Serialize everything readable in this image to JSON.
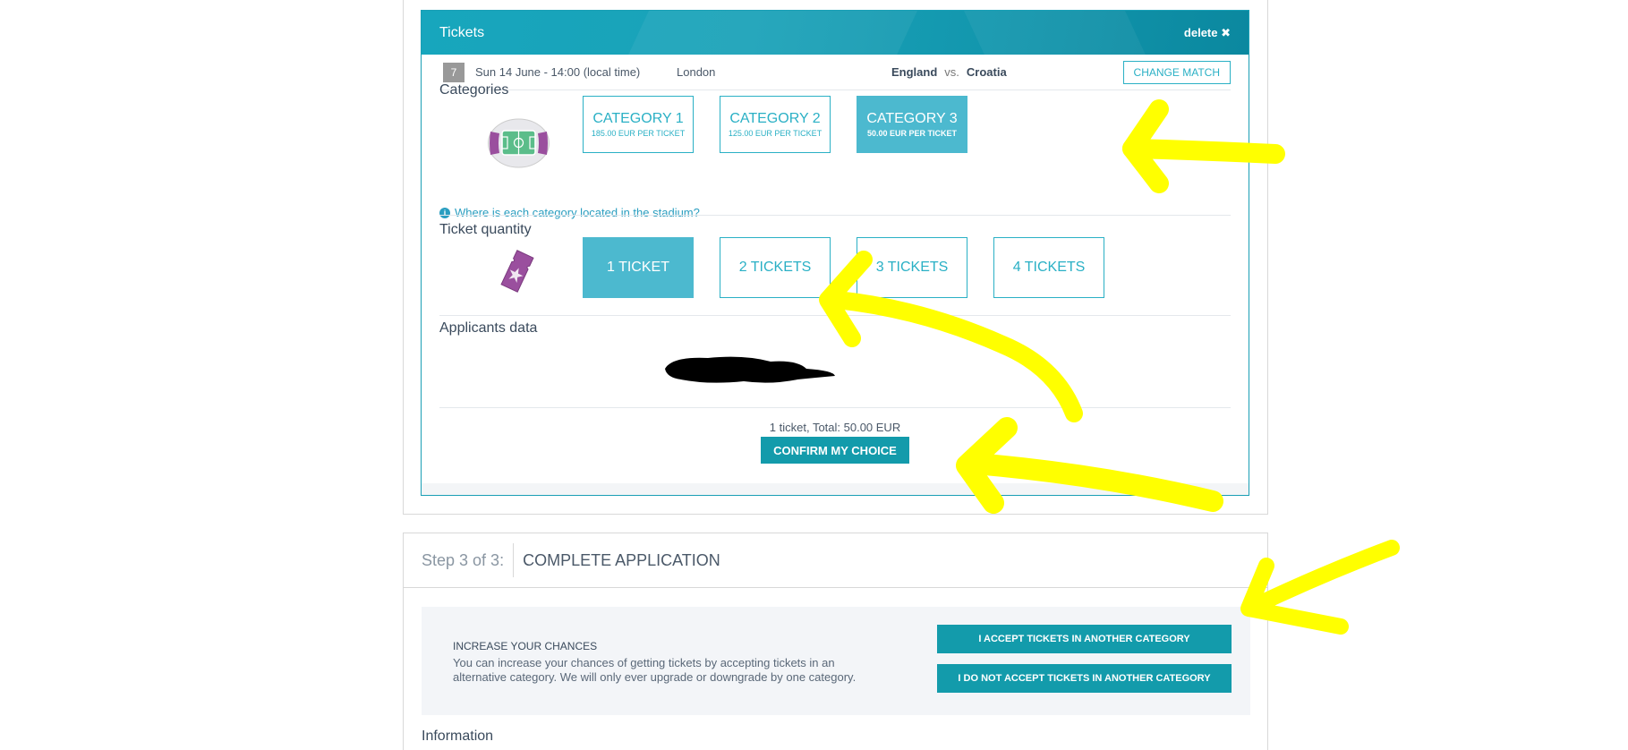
{
  "tickets": {
    "title": "Tickets",
    "delete_label": "delete ✖",
    "match": {
      "number": "7",
      "date": "Sun 14 June - 14:00 (local time)",
      "city": "London",
      "home": "England",
      "vs": "vs.",
      "away": "Croatia",
      "change_label": "CHANGE MATCH"
    },
    "categories_title": "Categories",
    "categories": [
      {
        "label": "CATEGORY 1",
        "price": "185.00 EUR PER TICKET",
        "selected": false
      },
      {
        "label": "CATEGORY 2",
        "price": "125.00 EUR PER TICKET",
        "selected": false
      },
      {
        "label": "CATEGORY 3",
        "price": "50.00 EUR PER TICKET",
        "selected": true
      }
    ],
    "stadium_link": "Where is each category located in the stadium?",
    "quantity_title": "Ticket quantity",
    "quantities": [
      {
        "label": "1 TICKET",
        "selected": true
      },
      {
        "label": "2 TICKETS",
        "selected": false
      },
      {
        "label": "3 TICKETS",
        "selected": false
      },
      {
        "label": "4 TICKETS",
        "selected": false
      }
    ],
    "applicants_title": "Applicants data",
    "total": "1 ticket, Total: 50.00 EUR",
    "confirm_label": "CONFIRM MY CHOICE"
  },
  "step3": {
    "step_label": "Step 3 of 3:",
    "step_name": "COMPLETE APPLICATION",
    "chances_title": "INCREASE YOUR CHANCES",
    "chances_text": "You can increase your chances of getting tickets by accepting tickets in an alternative category. We will only ever upgrade or downgrade by one category.",
    "accept_label": "I ACCEPT TICKETS IN ANOTHER CATEGORY",
    "decline_label": "I DO NOT ACCEPT TICKETS IN ANOTHER CATEGORY",
    "information_title": "Information"
  },
  "colors": {
    "accent": "#139bab",
    "selected": "#4cb9cf",
    "annotation": "#ffff00"
  }
}
